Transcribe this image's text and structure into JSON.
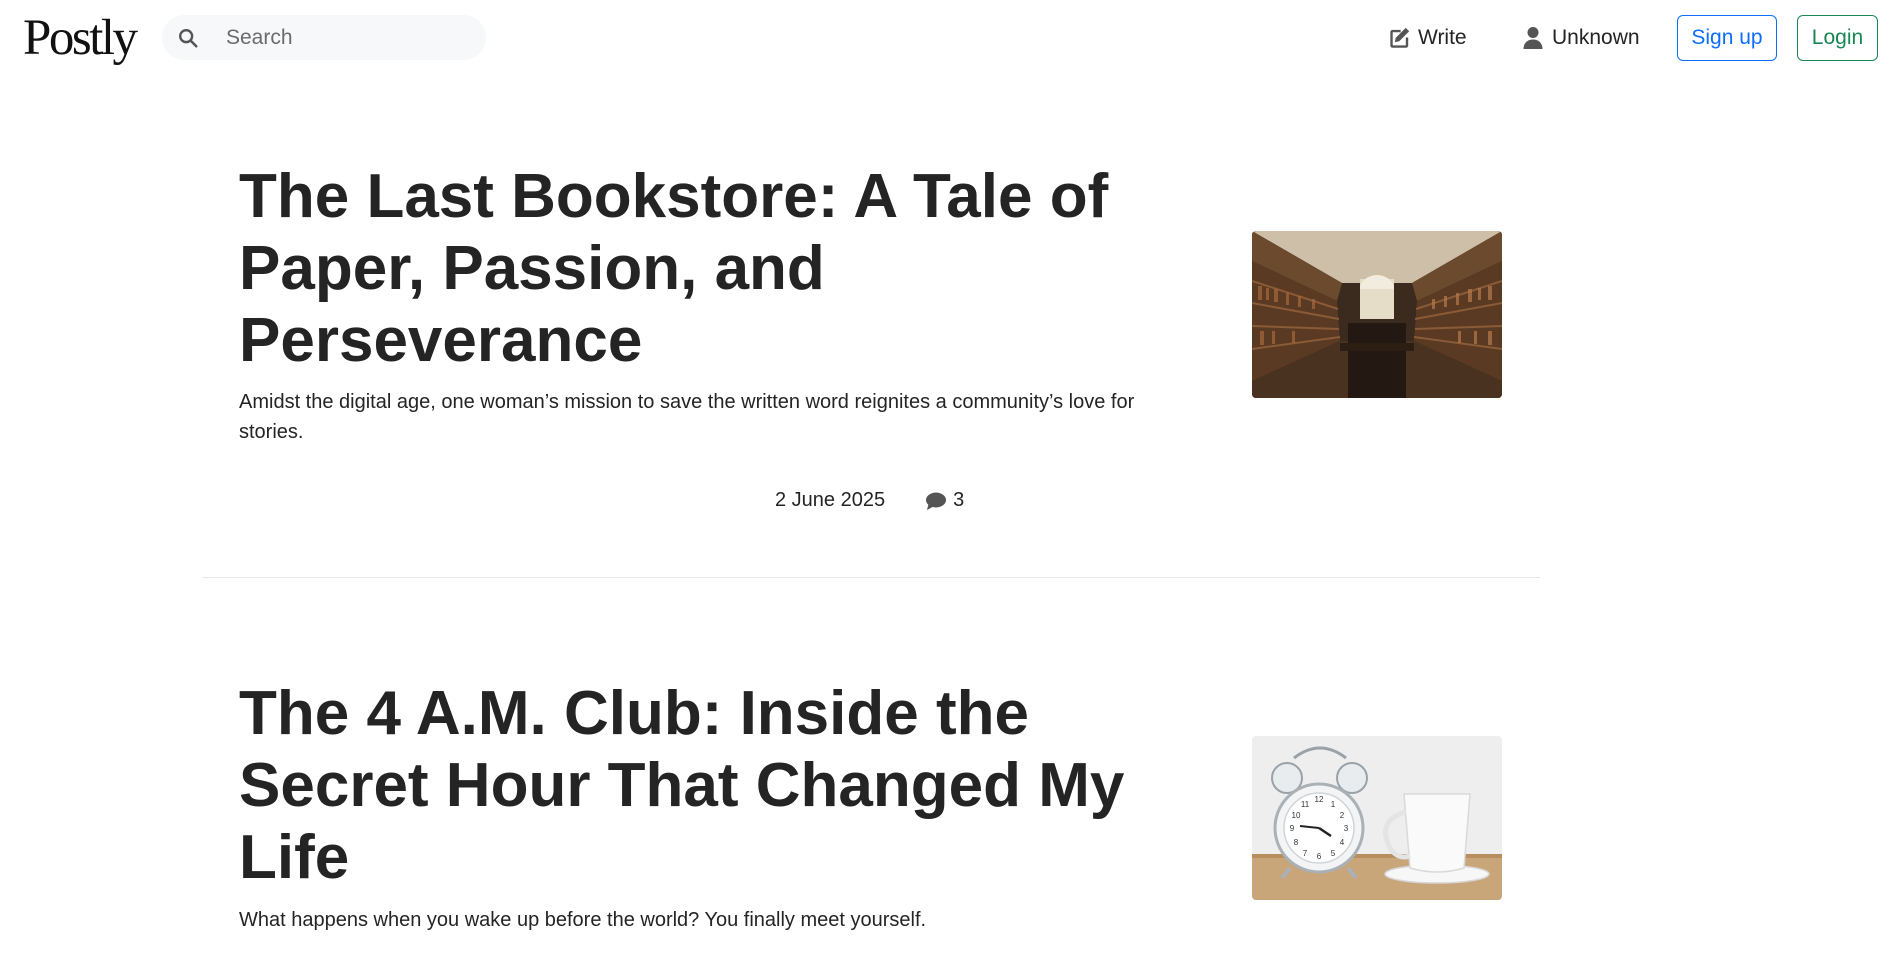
{
  "header": {
    "logo": "Postly",
    "search": {
      "placeholder": "Search",
      "value": ""
    },
    "write_label": "Write",
    "user_label": "Unknown",
    "signup_label": "Sign up",
    "login_label": "Login"
  },
  "articles": [
    {
      "title": "The Last Bookstore: A Tale of Paper, Passion, and Perseverance",
      "subtitle": "Amidst the digital age, one woman’s mission to save the written word reignites a community’s love for stories.",
      "date": "2 June 2025",
      "comments": "3",
      "image": "library-photo"
    },
    {
      "title": "The 4 A.M. Club: Inside the Secret Hour That Changed My Life",
      "subtitle": "What happens when you wake up before the world? You finally meet yourself.",
      "image": "alarm-clock-coffee-photo"
    }
  ],
  "colors": {
    "signup": "#0d6efd",
    "login": "#198754",
    "text": "#242424",
    "divider": "#e6e6e6"
  }
}
